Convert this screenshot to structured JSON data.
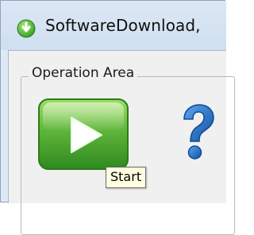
{
  "window": {
    "title": "SoftwareDownload,",
    "icon": "download-arrow-icon"
  },
  "operation_area": {
    "legend": "Operation Area",
    "start_button": {
      "icon": "play-icon"
    },
    "help_button": {
      "icon": "question-mark-icon"
    }
  },
  "tooltip": {
    "text": "Start"
  },
  "colors": {
    "play_green_light": "#7fd04a",
    "play_green_dark": "#2f8a1f",
    "help_blue": "#1e6fc4",
    "tooltip_bg": "#ffffe1",
    "titlebar_bg": "#dce7f4"
  }
}
